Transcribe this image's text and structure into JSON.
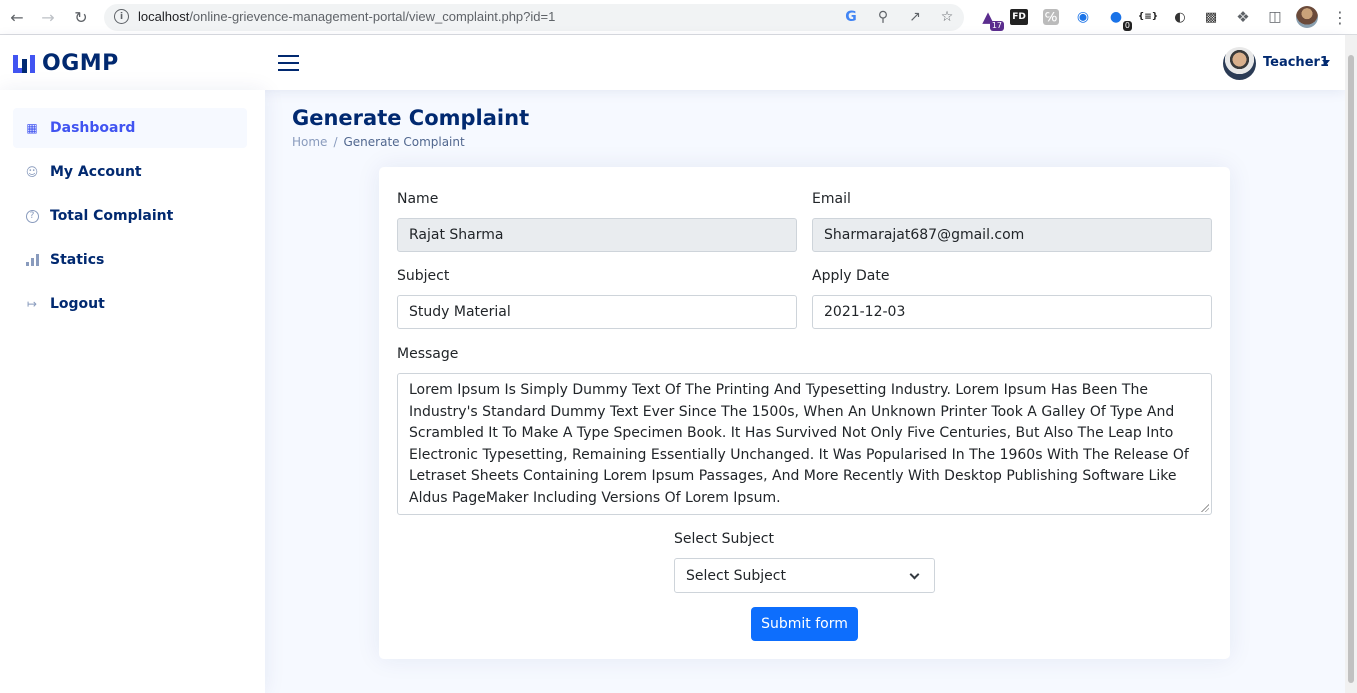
{
  "browser": {
    "url_host": "localhost",
    "url_path": "/online-grievence-management-portal/view_complaint.php?id=1",
    "extensions": [
      {
        "icon": "graduation-cap-icon",
        "badge": "17"
      },
      {
        "icon": "fd-icon",
        "text": "FD"
      },
      {
        "icon": "grey-ext-icon"
      },
      {
        "icon": "screen-record-icon"
      },
      {
        "icon": "blue-ext-icon",
        "badge": "0"
      },
      {
        "icon": "json-icon",
        "text": "{≡}"
      },
      {
        "icon": "g-ext-icon"
      },
      {
        "icon": "download-doc-icon"
      },
      {
        "icon": "puzzle-icon"
      },
      {
        "icon": "side-panel-icon"
      }
    ]
  },
  "header": {
    "logo_text": "OGMP",
    "user_name": "Teacher1"
  },
  "sidebar": {
    "items": [
      {
        "label": "Dashboard",
        "icon": "grid-icon",
        "active": true
      },
      {
        "label": "My Account",
        "icon": "person-icon"
      },
      {
        "label": "Total Complaint",
        "icon": "question-circle-icon"
      },
      {
        "label": "Statics",
        "icon": "bar-chart-icon"
      },
      {
        "label": "Logout",
        "icon": "box-arrow-right-icon"
      }
    ]
  },
  "page": {
    "title": "Generate Complaint",
    "breadcrumb": {
      "home": "Home",
      "separator": "/",
      "current": "Generate Complaint"
    }
  },
  "form": {
    "name_label": "Name",
    "name_value": "Rajat Sharma",
    "email_label": "Email",
    "email_value": "Sharmarajat687@gmail.com",
    "subject_label": "Subject",
    "subject_value": "Study Material",
    "apply_date_label": "Apply Date",
    "apply_date_value": "2021-12-03",
    "message_label": "Message",
    "message_value": "Lorem Ipsum Is Simply Dummy Text Of The Printing And Typesetting Industry. Lorem Ipsum Has Been The Industry's Standard Dummy Text Ever Since The 1500s, When An Unknown Printer Took A Galley Of Type And Scrambled It To Make A Type Specimen Book. It Has Survived Not Only Five Centuries, But Also The Leap Into Electronic Typesetting, Remaining Essentially Unchanged. It Was Popularised In The 1960s With The Release Of Letraset Sheets Containing Lorem Ipsum Passages, And More Recently With Desktop Publishing Software Like Aldus PageMaker Including Versions Of Lorem Ipsum.",
    "select_subject_label": "Select Subject",
    "select_subject_value": "Select Subject",
    "submit_label": "Submit form"
  },
  "colors": {
    "brand": "#4154f1",
    "heading": "#012970",
    "submit": "#0d6efd",
    "page_bg": "#f6f9ff"
  }
}
